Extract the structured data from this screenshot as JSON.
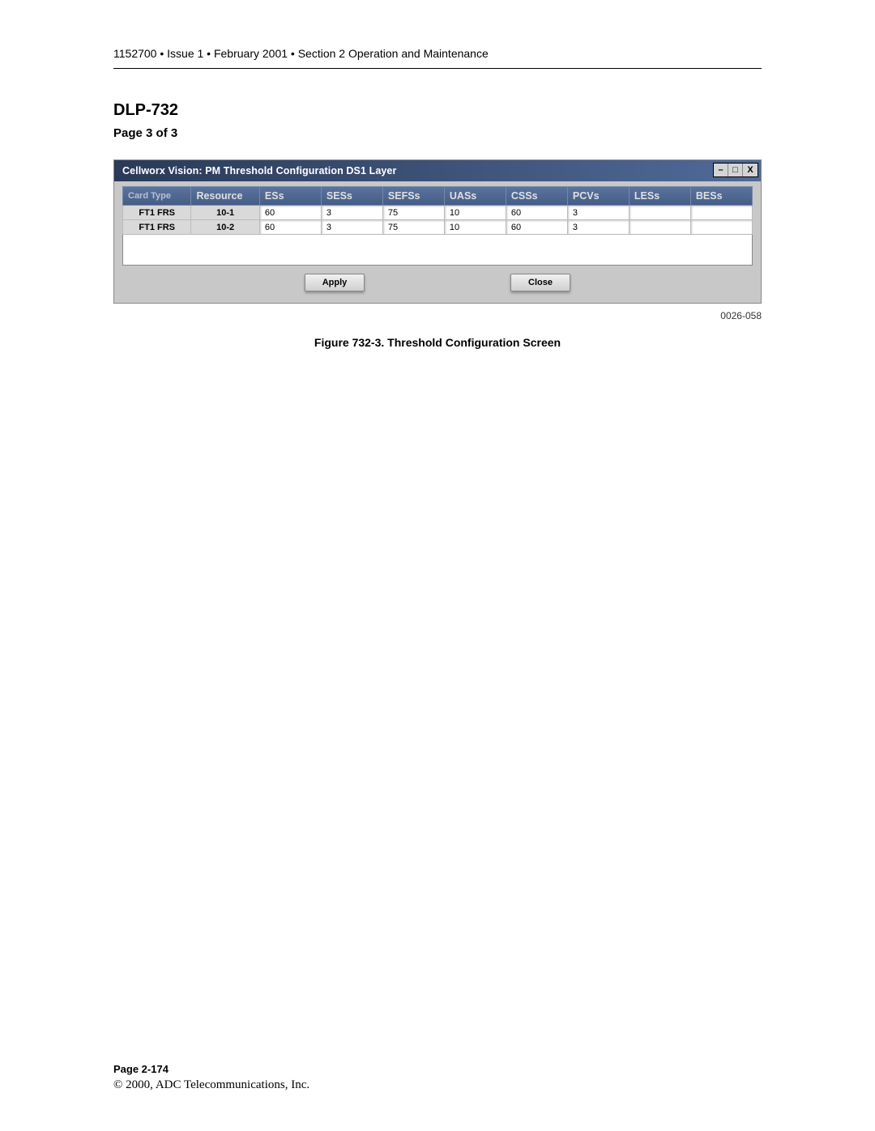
{
  "header": {
    "text": "1152700 • Issue 1 • February 2001 • Section 2 Operation and Maintenance"
  },
  "document": {
    "title": "DLP-732",
    "page_indicator": "Page 3 of 3"
  },
  "window": {
    "title": "Cellworx Vision:   PM Threshold Configuration DS1 Layer",
    "controls": {
      "minimize": "–",
      "maximize": "□",
      "close": "X"
    }
  },
  "table": {
    "headers": [
      "Card Type",
      "Resource",
      "ESs",
      "SESs",
      "SEFSs",
      "UASs",
      "CSSs",
      "PCVs",
      "LESs",
      "BESs"
    ],
    "rows": [
      {
        "card_type": "FT1 FRS",
        "resource": "10-1",
        "ess": "60",
        "sess": "3",
        "sefss": "75",
        "uass": "10",
        "csss": "60",
        "pcvs": "3",
        "less": "",
        "bess": ""
      },
      {
        "card_type": "FT1 FRS",
        "resource": "10-2",
        "ess": "60",
        "sess": "3",
        "sefss": "75",
        "uass": "10",
        "csss": "60",
        "pcvs": "3",
        "less": "",
        "bess": ""
      }
    ]
  },
  "buttons": {
    "apply": "Apply",
    "close": "Close"
  },
  "figure": {
    "ref": "0026-058",
    "caption": "Figure 732-3.  Threshold Configuration Screen"
  },
  "footer": {
    "page_num": "Page 2-174",
    "copyright": "© 2000, ADC Telecommunications, Inc."
  }
}
